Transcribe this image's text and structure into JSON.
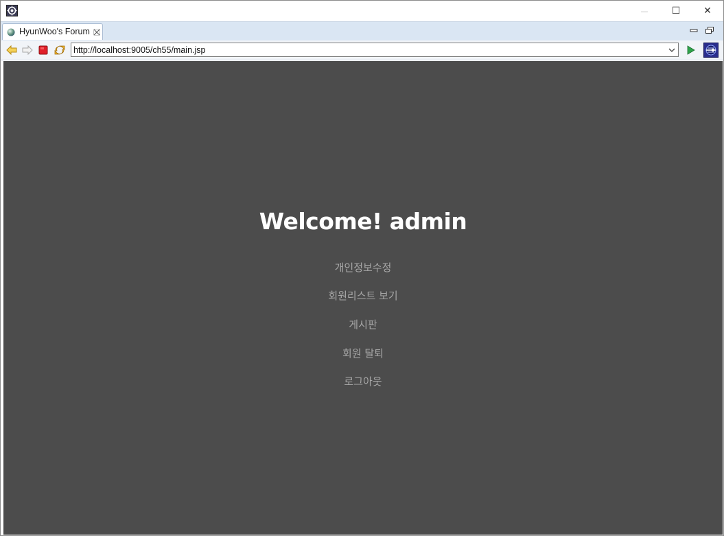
{
  "window": {
    "minimize_glyph": "—",
    "maximize_glyph": "☐",
    "close_glyph": "✕"
  },
  "tab": {
    "title": "HyunWoo's Forum"
  },
  "toolbar": {
    "url": "http://localhost:9005/ch55/main.jsp"
  },
  "page": {
    "welcome": "Welcome! admin",
    "links": [
      "개인정보수정",
      "회원리스트 보기",
      "게시판",
      "회원 탈퇴",
      "로그아웃"
    ]
  },
  "colors": {
    "content_background": "#4c4c4c",
    "welcome_text": "#ffffff",
    "link_text": "#a7a7a7",
    "tabbar": "#dae6f3"
  },
  "icons": [
    "eclipse-app-icon",
    "globe-icon",
    "tab-close-icon",
    "view-minimize-icon",
    "view-restore-icon",
    "back-arrow-icon",
    "forward-arrow-icon",
    "stop-icon",
    "refresh-icon",
    "dropdown-chevron-icon",
    "go-play-icon",
    "eclipse-logo-icon"
  ]
}
